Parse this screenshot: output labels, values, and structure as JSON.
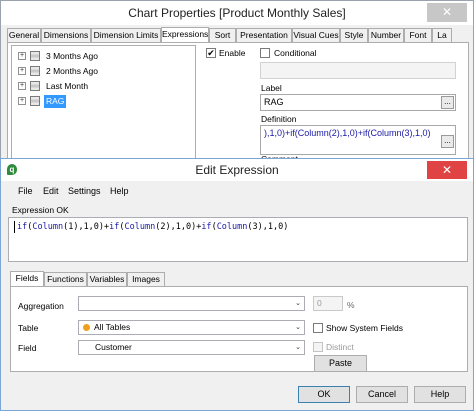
{
  "chart_properties": {
    "title": "Chart Properties [Product Monthly Sales]",
    "tabs": [
      "General",
      "Dimensions",
      "Dimension Limits",
      "Expressions",
      "Sort",
      "Presentation",
      "Visual Cues",
      "Style",
      "Number",
      "Font",
      "La"
    ],
    "active_tab": "Expressions",
    "expressions": [
      "3 Months Ago",
      "2 Months Ago",
      "Last Month",
      "RAG"
    ],
    "selected_expression": "RAG",
    "enable_label": "Enable",
    "conditional_label": "Conditional",
    "label_field_label": "Label",
    "label_value": "RAG",
    "definition_label": "Definition",
    "definition_value": "),1,0)+if(Column(2),1,0)+if(Column(3),1,0)",
    "comment_label": "Comment",
    "dots_label": "..."
  },
  "edit_expression": {
    "title": "Edit Expression",
    "app_icon": "qlik-icon",
    "menu": [
      "File",
      "Edit",
      "Settings",
      "Help"
    ],
    "status": "Expression OK",
    "expression": {
      "p1": "if",
      "p2": "(",
      "p3": "Column",
      "p4": "(1),1,0)+",
      "p5": "if",
      "p6": "(",
      "p7": "Column",
      "p8": "(2),1,0)+",
      "p9": "if",
      "p10": "(",
      "p11": "Column",
      "p12": "(3),1,0)"
    },
    "tabs": [
      "Fields",
      "Functions",
      "Variables",
      "Images"
    ],
    "active_tab": "Fields",
    "aggregation_label": "Aggregation",
    "aggregation_value": "",
    "aggregation_number": "0",
    "percent_sign": "%",
    "table_label": "Table",
    "table_value": "All Tables",
    "show_system_fields_label": "Show System Fields",
    "field_label": "Field",
    "field_value": "Customer",
    "distinct_label": "Distinct",
    "paste_button": "Paste",
    "ok_button": "OK",
    "cancel_button": "Cancel",
    "help_button": "Help"
  },
  "colors": {
    "selection": "#3399ff",
    "close_active": "#e04343",
    "keyword": "#1a1aa6",
    "all_tables_dot": "#f0a020"
  },
  "icons": {
    "close": "✕",
    "plus": "+",
    "check": "✔",
    "chevron": "⌄"
  }
}
